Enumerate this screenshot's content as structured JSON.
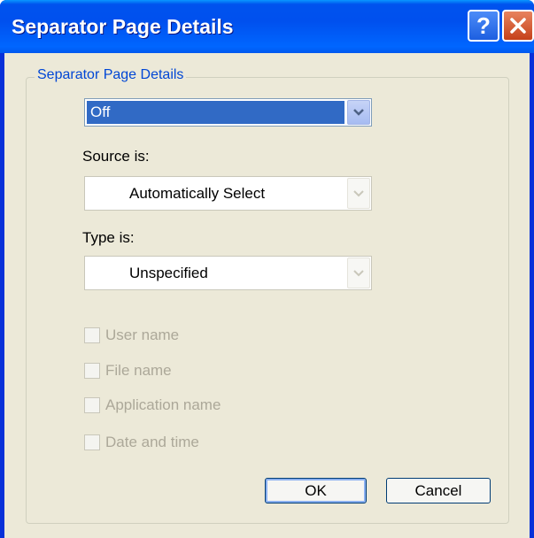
{
  "window": {
    "title": "Separator Page Details",
    "help_icon": "help-icon",
    "close_icon": "close-icon"
  },
  "group": {
    "legend": "Separator Page Details"
  },
  "separator_select": {
    "value": "Off"
  },
  "source": {
    "label": "Source is:",
    "value": "Automatically Select"
  },
  "type": {
    "label": "Type is:",
    "value": "Unspecified"
  },
  "options": [
    {
      "label": "User name",
      "checked": false,
      "enabled": false
    },
    {
      "label": "File name",
      "checked": false,
      "enabled": false
    },
    {
      "label": "Application name",
      "checked": false,
      "enabled": false
    },
    {
      "label": "Date and time",
      "checked": false,
      "enabled": false
    }
  ],
  "buttons": {
    "ok": "OK",
    "cancel": "Cancel"
  },
  "colors": {
    "titlebar": "#0054e3",
    "dialog_bg": "#ece9d8",
    "legend_text": "#0046d5",
    "selection": "#316ac5",
    "disabled_text": "#aca899"
  }
}
